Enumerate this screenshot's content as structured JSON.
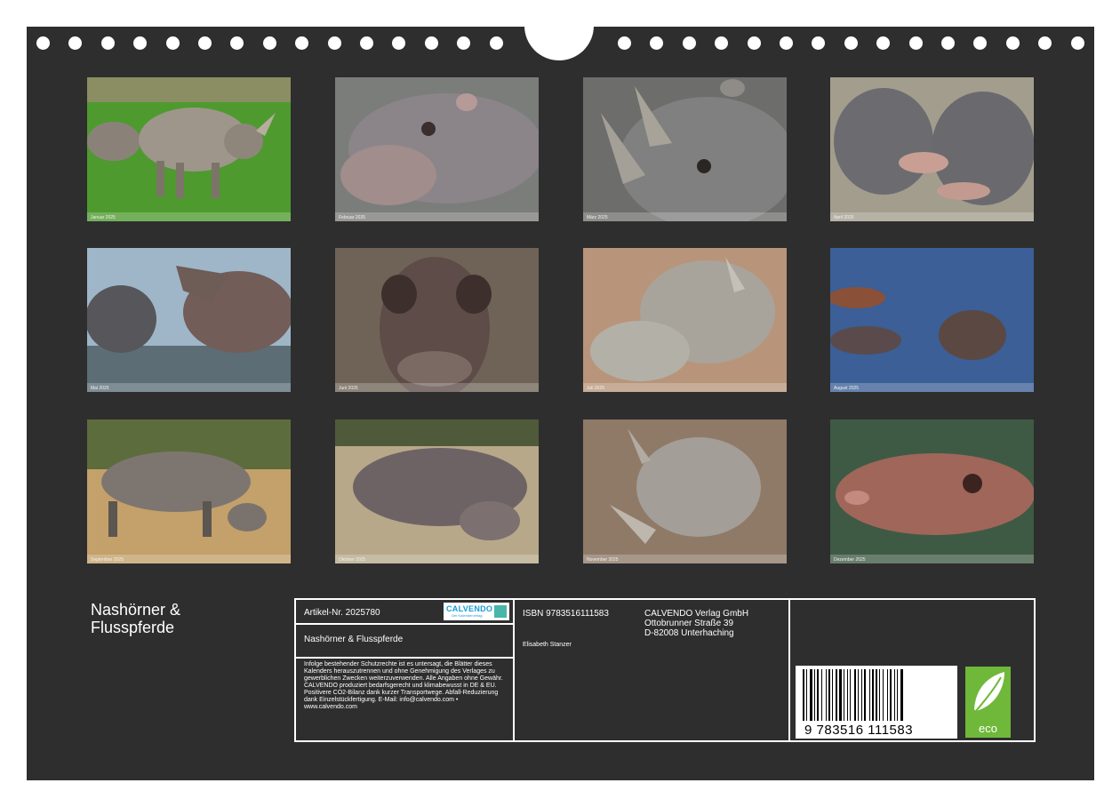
{
  "calendar": {
    "title": "Nashörner & Flusspferde",
    "months": [
      {
        "label": "Januar 2025"
      },
      {
        "label": "Februar 2025"
      },
      {
        "label": "März 2025"
      },
      {
        "label": "April 2025"
      },
      {
        "label": "Mai 2025"
      },
      {
        "label": "Juni 2025"
      },
      {
        "label": "Juli 2025"
      },
      {
        "label": "August 2025"
      },
      {
        "label": "September 2025"
      },
      {
        "label": "Oktober 2025"
      },
      {
        "label": "November 2025"
      },
      {
        "label": "Dezember 2025"
      }
    ]
  },
  "info": {
    "article": "Artikel-Nr. 2025780",
    "product_title": "Nashörner & Flusspferde",
    "legal_text": "Infolge bestehender Schutzrechte ist es untersagt, die Blätter dieses Kalenders herauszutrennen und ohne Genehmigung des Verlages zu gewerblichen Zwecken weiterzuverwenden. Alle Angaben ohne Gewähr. CALVENDO produziert bedarfsgerecht und klimabewusst in DE & EU. Positivere CO2-Bilanz dank kurzer Transportwege. Abfall-Reduzierung dank Einzelstückfertigung. E-Mail: info@calvendo.com • www.calvendo.com",
    "isbn": "ISBN 9783516111583",
    "author": "Elisabeth Stanzer",
    "publisher_line1": "CALVENDO Verlag GmbH",
    "publisher_line2": "Ottobrunner Straße 39",
    "publisher_line3": "D-82008 Unterhaching",
    "logo_text": "CALVENDO",
    "logo_sub": "Der Kalenderverlag",
    "barcode_number": "9 783516 111583",
    "eco_label": "eco"
  },
  "colors": {
    "background": "#2e2e2e",
    "accent_logo": "#1a9bd7",
    "eco_green": "#6fb83a"
  }
}
